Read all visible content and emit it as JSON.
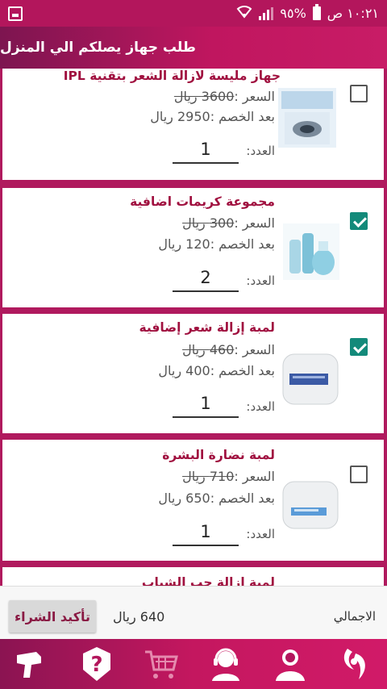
{
  "status_bar": {
    "time": "١٠:٢١ ص",
    "battery": "%٩٥"
  },
  "header": {
    "title": "طلب جهاز يصلكم الي المنزل"
  },
  "labels": {
    "price_prefix": "السعر :",
    "after_discount_prefix": "بعد الخصم :",
    "qty_label": "العدد:"
  },
  "products": [
    {
      "title": "جهاز مليسة لازالة الشعر بتقنية IPL",
      "old_price": "3600 ريال",
      "new_price": "2950 ريال",
      "qty": "1",
      "checked": false,
      "image": "ipl-device-image"
    },
    {
      "title": "مجموعة كريمات اضافية",
      "old_price": "300 ريال",
      "new_price": "120 ريال",
      "qty": "2",
      "checked": true,
      "image": "cream-set-image"
    },
    {
      "title": "لمبة إزالة شعر إضافية",
      "old_price": "460 ريال",
      "new_price": "400 ريال",
      "qty": "1",
      "checked": true,
      "image": "hair-removal-lamp-image"
    },
    {
      "title": "لمبة نضارة البشرة",
      "old_price": "710 ريال",
      "new_price": "650 ريال",
      "qty": "1",
      "checked": false,
      "image": "skin-lamp-image"
    },
    {
      "title": "لمبة إزالة حب الشباب",
      "old_price": "",
      "new_price": "",
      "qty": "",
      "checked": false,
      "image": ""
    }
  ],
  "summary": {
    "total_label": "الاجمالي",
    "total_value": "640 ريال",
    "confirm_label": "تأكيد الشراء"
  },
  "colors": {
    "brand": "#b3165c",
    "title_text": "#a0103f",
    "checkbox_checked": "#138a7a"
  },
  "bottom_nav": [
    "device-icon",
    "question-icon",
    "cart-icon",
    "support-icon",
    "user-icon",
    "logo-icon"
  ]
}
